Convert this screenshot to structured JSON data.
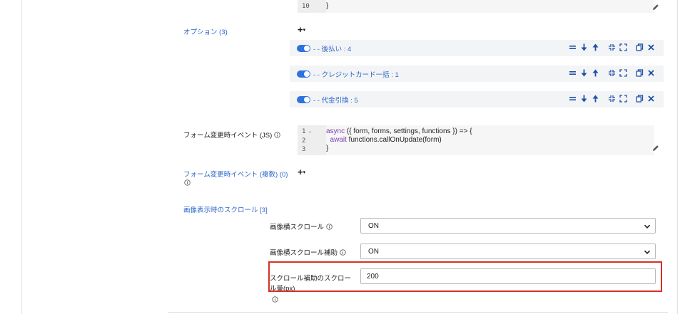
{
  "top_code": {
    "line_number": "10",
    "code_line": "}"
  },
  "options": {
    "label": "オプション (3)",
    "add_symbol": "+",
    "caret": "▾",
    "items": [
      {
        "text": "- - 後払い : 4"
      },
      {
        "text": "- - クレジットカード一括 : 1"
      },
      {
        "text": "- - 代金引換 : 5"
      }
    ]
  },
  "form_change_event": {
    "label": "フォーム変更時イベント (JS)",
    "lines": [
      {
        "n": "1",
        "fold": "⌄",
        "kw": "async",
        "rest": " ({ form, forms, settings, functions }) => {"
      },
      {
        "n": "2",
        "fold": "",
        "kw": "  await",
        "rest": " functions.callOnUpdate(form)"
      },
      {
        "n": "3",
        "fold": "",
        "kw": "",
        "rest": "}"
      }
    ]
  },
  "form_change_events_multi": {
    "label": "フォーム変更時イベント (複数) (0)",
    "add_symbol": "+",
    "caret": "▾"
  },
  "image_scroll": {
    "section_label": "画像表示時のスクロール [3]",
    "horizontal_scroll": {
      "label": "画像横スクロール",
      "value": "ON"
    },
    "horizontal_scroll_assist": {
      "label": "画像横スクロール補助",
      "value": "ON"
    },
    "scroll_assist_amount": {
      "label_line1": "スクロール補助のスクロー",
      "label_line2": "ル量(px)",
      "value": "200"
    }
  },
  "colors": {
    "accent": "#2b66c8",
    "toggle_on": "#2d73e0",
    "highlight": "#d93025",
    "icon": "#1f4fa8"
  }
}
